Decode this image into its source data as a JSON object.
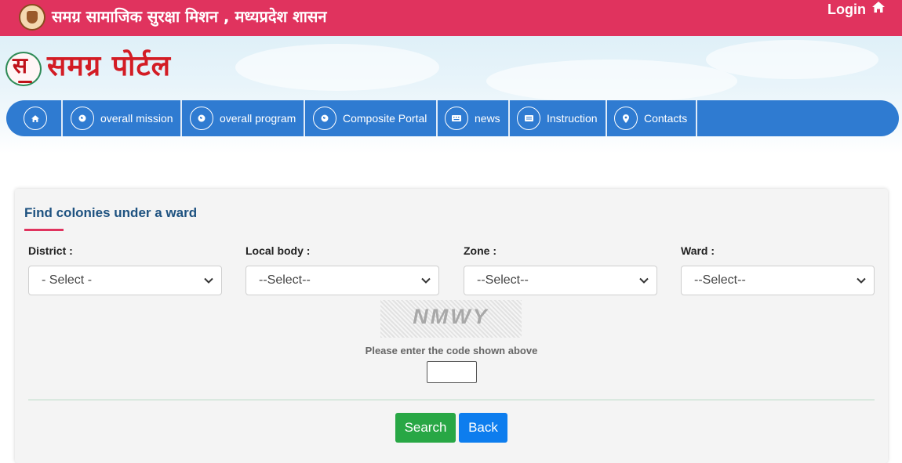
{
  "header": {
    "org_title": "समग्र सामाजिक सुरक्षा मिशन , मध्यप्रदेश शासन",
    "login_label": "Login",
    "login_icon": "home-icon",
    "emblem_icon": "state-emblem-icon"
  },
  "brand": {
    "logo_mark": "स",
    "logo_text": "समग्र पोर्टल"
  },
  "nav": {
    "home_icon": "home-icon",
    "items": [
      {
        "label": "overall mission",
        "icon": "globe-icon"
      },
      {
        "label": "overall program",
        "icon": "globe-icon"
      },
      {
        "label": "Composite Portal",
        "icon": "globe-icon"
      },
      {
        "label": "news",
        "icon": "keyboard-icon"
      },
      {
        "label": "Instruction",
        "icon": "list-icon"
      },
      {
        "label": "Contacts",
        "icon": "map-marker-icon"
      }
    ]
  },
  "form": {
    "title": "Find colonies under a ward",
    "fields": [
      {
        "label": "District :",
        "selected": "- Select -"
      },
      {
        "label": "Local body :",
        "selected": "--Select--"
      },
      {
        "label": "Zone :",
        "selected": "--Select--"
      },
      {
        "label": "Ward :",
        "selected": "--Select--"
      }
    ],
    "captcha_code": "NMWY",
    "captcha_hint": "Please enter the code shown above",
    "captcha_value": "",
    "search_label": "Search",
    "back_label": "Back"
  },
  "colors": {
    "header_bg": "#e0335e",
    "nav_bg": "#2f7bd1",
    "title_color": "#1e5280",
    "search_btn": "#28a745",
    "back_btn": "#0d7dee",
    "logo_red": "#d31c24"
  }
}
